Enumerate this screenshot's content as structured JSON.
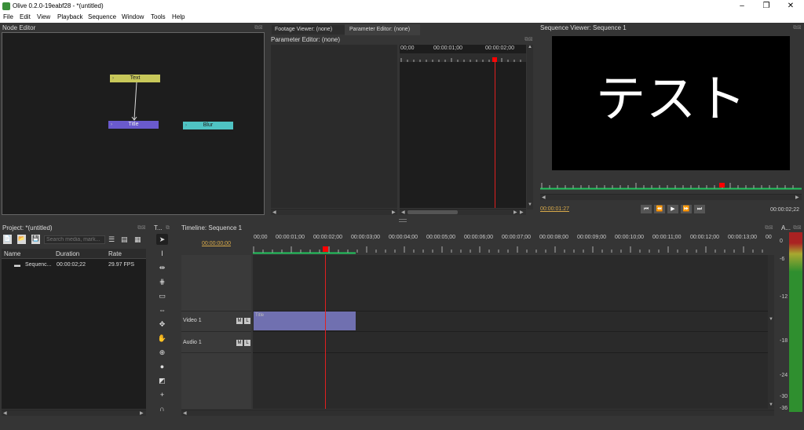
{
  "window": {
    "title": "Olive 0.2.0-19eabf28 - *(untitled)",
    "minimize": "–",
    "maximize": "❐",
    "close": "✕"
  },
  "menu": [
    "File",
    "Edit",
    "View",
    "Playback",
    "Sequence",
    "Window",
    "Tools",
    "Help"
  ],
  "node_editor": {
    "title": "Node Editor",
    "nodes": [
      {
        "label": "Text",
        "color": "#c8c85a"
      },
      {
        "label": "Title",
        "color": "#6a5acd"
      },
      {
        "label": "Blur",
        "color": "#4fc3c3"
      }
    ]
  },
  "param_area": {
    "tabs": [
      "Footage Viewer: (none)",
      "Parameter Editor: (none)"
    ],
    "subtitle": "Parameter Editor: (none)",
    "ruler_codes": [
      "00;00",
      "00:00:01;00",
      "00:00:02;00"
    ]
  },
  "sequence_viewer": {
    "title": "Sequence Viewer: Sequence 1",
    "preview_text": "テスト",
    "current_time": "00:00:01:27",
    "end_time": "00:00:02;22",
    "controls": [
      "⏮",
      "⏪",
      "▶",
      "⏩",
      "⏭"
    ]
  },
  "project": {
    "title": "Project: *(untitled)",
    "search_placeholder": "Search media, mark...",
    "columns": [
      "Name",
      "Duration",
      "Rate"
    ],
    "rows": [
      {
        "name": "Sequenc...",
        "duration": "00:00:02;22",
        "rate": "29.97 FPS"
      }
    ]
  },
  "tools_panel": {
    "title": "T..."
  },
  "timeline": {
    "title": "Timeline: Sequence 1",
    "current_time": "00:00:00;00",
    "ruler_codes": [
      "00;00",
      "00:00:01;00",
      "00:00:02;00",
      "00:00:03;00",
      "00:00:04;00",
      "00:00:05;00",
      "00:00:06;00",
      "00:00:07;00",
      "00:00:08;00",
      "00:00:09;00",
      "00:00:10;00",
      "00:00:11;00",
      "00:00:12;00",
      "00:00:13;00",
      "00"
    ],
    "tracks": [
      {
        "name": "Video 1",
        "m": "M",
        "l": "L"
      },
      {
        "name": "Audio 1",
        "m": "M",
        "l": "L"
      }
    ],
    "clip": {
      "label": "Title",
      "color": "#7070b0"
    }
  },
  "audio_meter": {
    "title": "A...",
    "labels": [
      "0",
      "-6",
      "-12",
      "-18",
      "-24",
      "-30",
      "-36"
    ]
  },
  "colors": {
    "playhead": "#ff0000",
    "accent_green": "#22c55e",
    "timecode": "#d7a94a"
  }
}
